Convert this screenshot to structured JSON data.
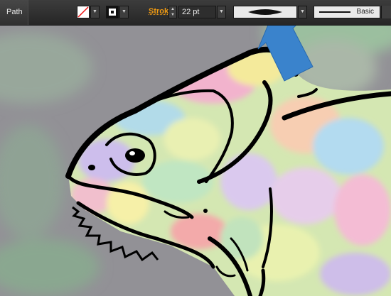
{
  "control_panel": {
    "selection_type": "Path",
    "fill_swatch": "none-swatch",
    "stroke_swatch": "stroke-color-swatch",
    "stroke_label": "Stroke:",
    "stroke_weight": "22 pt",
    "variable_width_profile": "width-profile-tapered",
    "brush_definition": "Basic"
  },
  "colors": {
    "toolbar_bg": "#2f2f2f",
    "stroke_label": "#f39c12",
    "arrow": "#3a83cc",
    "canvas_bg": "#8f8f93"
  },
  "icons": {
    "dropdown": "chevron-down-icon",
    "stepper": "up-down-stepper-icon",
    "pointer": "blue-arrow-pointer"
  }
}
